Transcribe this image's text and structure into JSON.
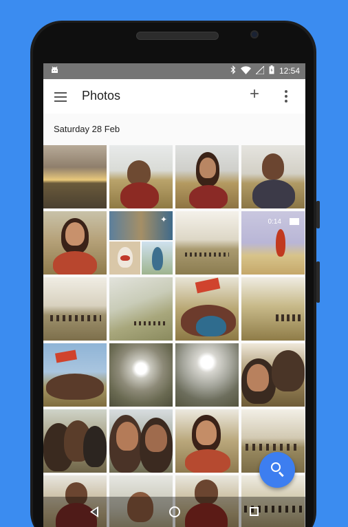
{
  "status_bar": {
    "time": "12:54"
  },
  "app_bar": {
    "title": "Photos",
    "add_label": "+"
  },
  "section": {
    "date": "Saturday 28 Feb"
  },
  "video_badge": {
    "duration": "0:14"
  },
  "colors": {
    "background": "#3b8cf0",
    "status_bar": "#757575",
    "fab": "#3d7ef0"
  },
  "photos": [
    {
      "kind": "sunset-landscape"
    },
    {
      "kind": "portrait-man-sunglasses"
    },
    {
      "kind": "portrait-woman"
    },
    {
      "kind": "portrait-man"
    },
    {
      "kind": "portrait-woman-smiling"
    },
    {
      "kind": "auto-collage-with-dog"
    },
    {
      "kind": "landscape-group-distance"
    },
    {
      "kind": "video-man-jumping"
    },
    {
      "kind": "landscape-group-distance"
    },
    {
      "kind": "hillside-landscape"
    },
    {
      "kind": "group-with-flag"
    },
    {
      "kind": "hillside-group"
    },
    {
      "kind": "group-with-flag-blue-sky"
    },
    {
      "kind": "sun-over-valley"
    },
    {
      "kind": "sun-over-valley"
    },
    {
      "kind": "group-selfie"
    },
    {
      "kind": "group-selfie-sunglasses"
    },
    {
      "kind": "selfie-two-people"
    },
    {
      "kind": "portrait-woman-blanket"
    },
    {
      "kind": "landscape-people-distance"
    },
    {
      "kind": "portrait-man-jumping"
    },
    {
      "kind": "portrait-man-smiling"
    },
    {
      "kind": "portrait-man-sunglasses"
    },
    {
      "kind": "landscape-people-distance"
    }
  ]
}
